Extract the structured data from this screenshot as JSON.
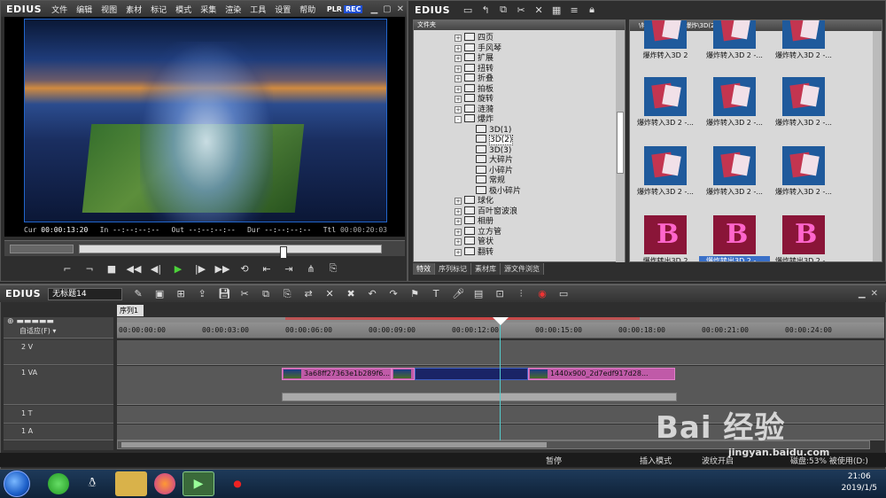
{
  "player": {
    "app_logo": "EDIUS",
    "menu": [
      "文件",
      "编辑",
      "视图",
      "素材",
      "标记",
      "模式",
      "采集",
      "渲染",
      "工具",
      "设置",
      "帮助"
    ],
    "plr_label": "PLR",
    "rec_label": "REC",
    "timecodes": {
      "cur_label": "Cur",
      "cur": "00:00:13:20",
      "in_label": "In",
      "in": "--:--:--:--",
      "out_label": "Out",
      "out": "--:--:--:--",
      "dur_label": "Dur",
      "dur": "--:--:--:--",
      "ttl_label": "Ttl",
      "ttl": "00:00:20:03"
    },
    "scrub_position": 0.68
  },
  "library": {
    "app_logo": "EDIUS",
    "tree_header": "文件夹",
    "path": "\\特效\\转场\\GPU\\爆炸\\3D(2)\\",
    "tree_items": [
      {
        "label": "四页",
        "depth": 0,
        "expander": "+"
      },
      {
        "label": "手风琴",
        "depth": 0,
        "expander": "+"
      },
      {
        "label": "扩展",
        "depth": 0,
        "expander": "+"
      },
      {
        "label": "扭转",
        "depth": 0,
        "expander": "+"
      },
      {
        "label": "折叠",
        "depth": 0,
        "expander": "+"
      },
      {
        "label": "拍板",
        "depth": 0,
        "expander": "+"
      },
      {
        "label": "旋转",
        "depth": 0,
        "expander": "+"
      },
      {
        "label": "涟漪",
        "depth": 0,
        "expander": "+"
      },
      {
        "label": "爆炸",
        "depth": 0,
        "expander": "-"
      },
      {
        "label": "3D(1)",
        "depth": 1,
        "expander": ""
      },
      {
        "label": "3D(2)",
        "depth": 1,
        "expander": "",
        "selected": true
      },
      {
        "label": "3D(3)",
        "depth": 1,
        "expander": ""
      },
      {
        "label": "大碎片",
        "depth": 1,
        "expander": ""
      },
      {
        "label": "小碎片",
        "depth": 1,
        "expander": ""
      },
      {
        "label": "常规",
        "depth": 1,
        "expander": ""
      },
      {
        "label": "极小碎片",
        "depth": 1,
        "expander": ""
      },
      {
        "label": "球化",
        "depth": 0,
        "expander": "+"
      },
      {
        "label": "百叶窗波浪",
        "depth": 0,
        "expander": "+"
      },
      {
        "label": "相册",
        "depth": 0,
        "expander": "+"
      },
      {
        "label": "立方管",
        "depth": 0,
        "expander": "+"
      },
      {
        "label": "管状",
        "depth": 0,
        "expander": "+"
      },
      {
        "label": "翻转",
        "depth": 0,
        "expander": "+"
      }
    ],
    "tabs": [
      "特效",
      "序列标记",
      "素材库",
      "源文件浏览"
    ],
    "active_tab": 0,
    "thumbnails": [
      {
        "caption": "爆炸转入3D 2",
        "style": "blue-partial"
      },
      {
        "caption": "爆炸转入3D 2 -...",
        "style": "blue-partial"
      },
      {
        "caption": "爆炸转入3D 2 -...",
        "style": "blue-partial"
      },
      {
        "caption": "爆炸转入3D 2 -...",
        "style": "blue"
      },
      {
        "caption": "爆炸转入3D 2 -...",
        "style": "blue"
      },
      {
        "caption": "爆炸转入3D 2 -...",
        "style": "blue"
      },
      {
        "caption": "爆炸转入3D 2 -...",
        "style": "blue"
      },
      {
        "caption": "爆炸转入3D 2 -...",
        "style": "blue"
      },
      {
        "caption": "爆炸转入3D 2 -...",
        "style": "blue"
      },
      {
        "caption": "爆炸转出3D 2",
        "style": "red"
      },
      {
        "caption": "爆炸转出3D 2 -...",
        "style": "red",
        "selected": true
      },
      {
        "caption": "爆炸转出3D 2 -...",
        "style": "red"
      }
    ]
  },
  "timeline": {
    "app_logo": "EDIUS",
    "project_name": "无标题14",
    "sequence_tab": "序列1",
    "adaptive_label": "自适应(F)",
    "ruler_ticks": [
      "00:00:00:00",
      "00:00:03:00",
      "00:00:06:00",
      "00:00:09:00",
      "00:00:12:00",
      "00:00:15:00",
      "00:00:18:00",
      "00:00:21:00",
      "00:00:24:00"
    ],
    "tracks": [
      {
        "name": "2 V"
      },
      {
        "name": "1 VA"
      },
      {
        "name": "1 T"
      },
      {
        "name": "1 A"
      }
    ],
    "clips": [
      {
        "label": "3a68ff27363e1b289f6..."
      },
      {
        "label": "1440x900_2d7edf917d28..."
      }
    ]
  },
  "status": {
    "pause": "暂停",
    "insert_mode": "插入模式",
    "ripple": "波纹开启",
    "disk": "磁盘:53% 被使用(D:)"
  },
  "taskbar": {
    "time": "21:06",
    "date": "2019/1/5"
  },
  "watermark": {
    "text": "Bai 经验",
    "url": "jingyan.baidu.com"
  }
}
